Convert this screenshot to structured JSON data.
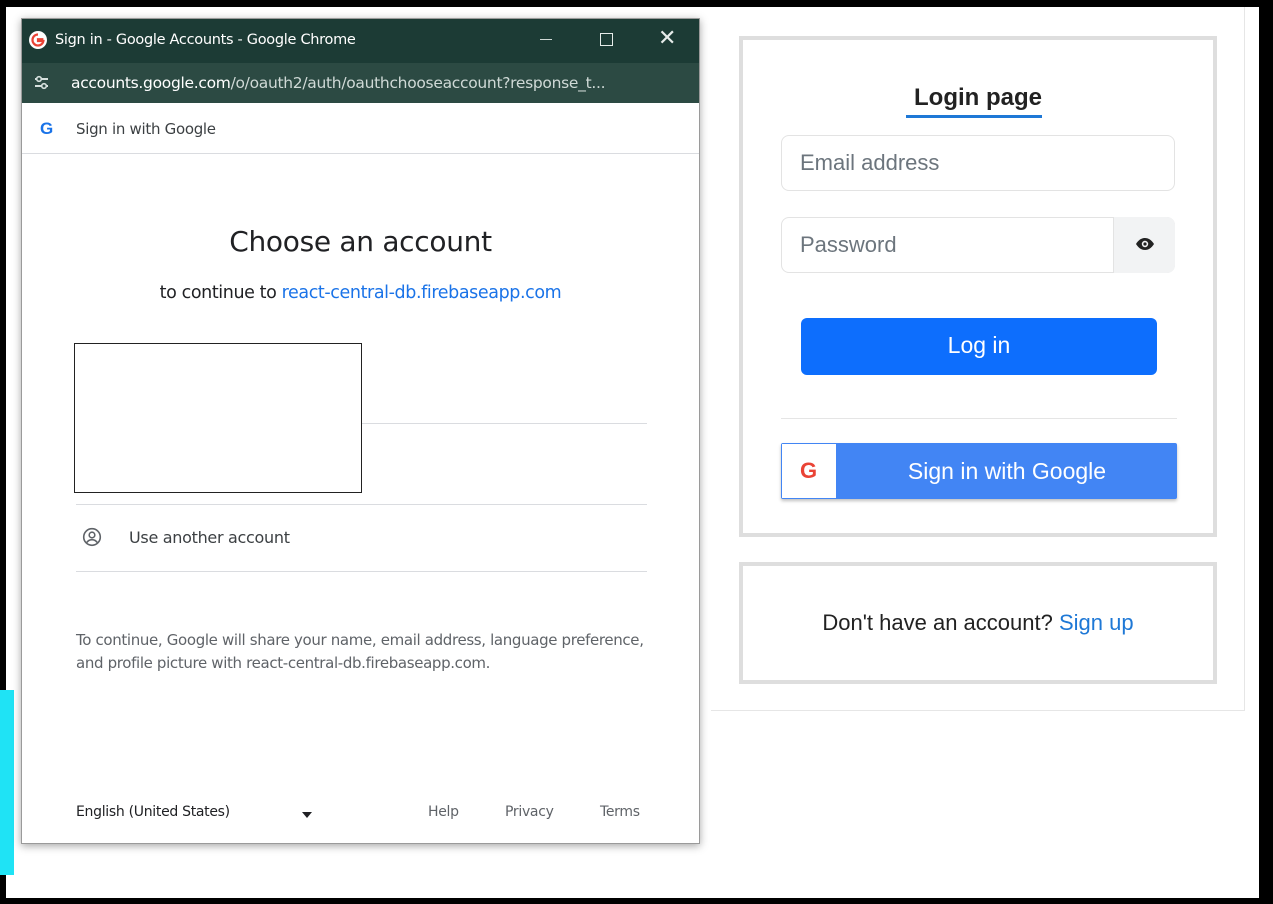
{
  "popup": {
    "window_title": "Sign in - Google Accounts - Google Chrome",
    "window_controls": {
      "minimize": "minimize-icon",
      "maximize": "maximize-icon",
      "close": "✕"
    },
    "url_host": "accounts.google.com",
    "url_path": "/o/oauth2/auth/oauthchooseaccount?response_t...",
    "header_logo": "G",
    "header_text": "Sign in with Google",
    "title": "Choose an account",
    "continue_prefix": "to continue to",
    "continue_domain": "react-central-db.firebaseapp.com",
    "use_another": "Use another account",
    "share_text": "To continue, Google will share your name, email address, language preference, and profile picture with react-central-db.firebaseapp.com.",
    "footer": {
      "language": "English (United States)",
      "help": "Help",
      "privacy": "Privacy",
      "terms": "Terms"
    }
  },
  "login": {
    "title": "Login page",
    "email_placeholder": "Email address",
    "password_placeholder": "Password",
    "login_button": "Log in",
    "google_logo": "G",
    "google_button": "Sign in with Google",
    "signup_prefix": "Don't have an account?",
    "signup_link": "Sign up"
  },
  "colors": {
    "titlebar": "#1c3b35",
    "urlbar": "#2c4a43",
    "google_blue": "#1a73e8",
    "primary_button": "#0d6efd",
    "google_button": "#4285f4"
  }
}
